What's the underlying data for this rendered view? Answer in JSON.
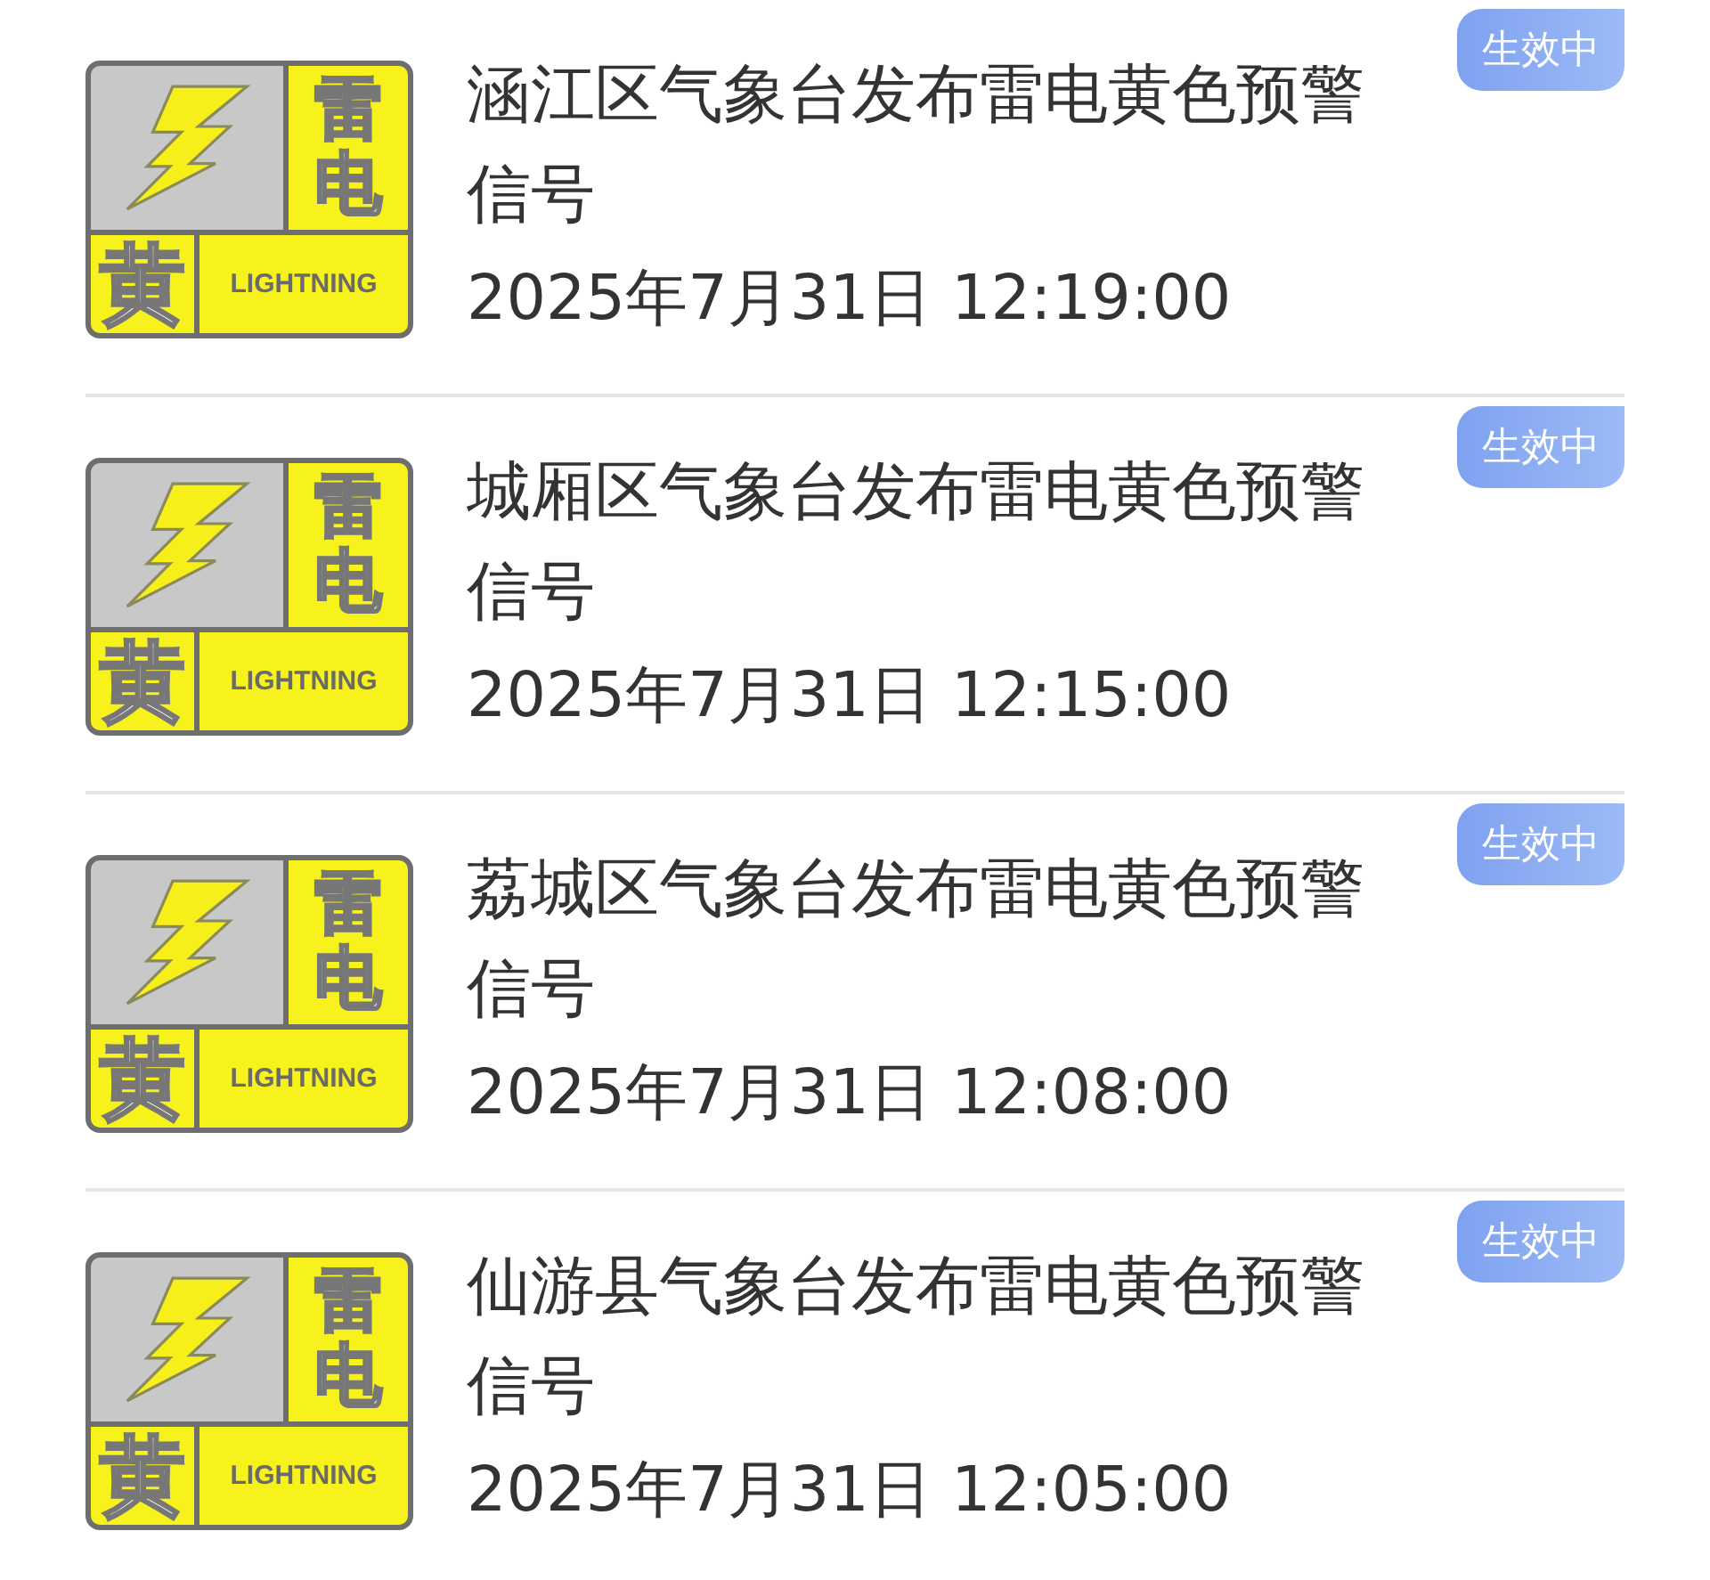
{
  "warnings": [
    {
      "title": "涵江区气象台发布雷电黄色预警信号",
      "time": "2025年7月31日 12:19:00",
      "status": "生效中",
      "signal": {
        "kind": "lightning",
        "name": "雷电",
        "level": "黄",
        "label": "LIGHTNING"
      }
    },
    {
      "title": "城厢区气象台发布雷电黄色预警信号",
      "time": "2025年7月31日 12:15:00",
      "status": "生效中",
      "signal": {
        "kind": "lightning",
        "name": "雷电",
        "level": "黄",
        "label": "LIGHTNING"
      }
    },
    {
      "title": "荔城区气象台发布雷电黄色预警信号",
      "time": "2025年7月31日 12:08:00",
      "status": "生效中",
      "signal": {
        "kind": "lightning",
        "name": "雷电",
        "level": "黄",
        "label": "LIGHTNING"
      }
    },
    {
      "title": "仙游县气象台发布雷电黄色预警信号",
      "time": "2025年7月31日 12:05:00",
      "status": "生效中",
      "signal": {
        "kind": "lightning",
        "name": "雷电",
        "level": "黄",
        "label": "LIGHTNING"
      }
    }
  ]
}
